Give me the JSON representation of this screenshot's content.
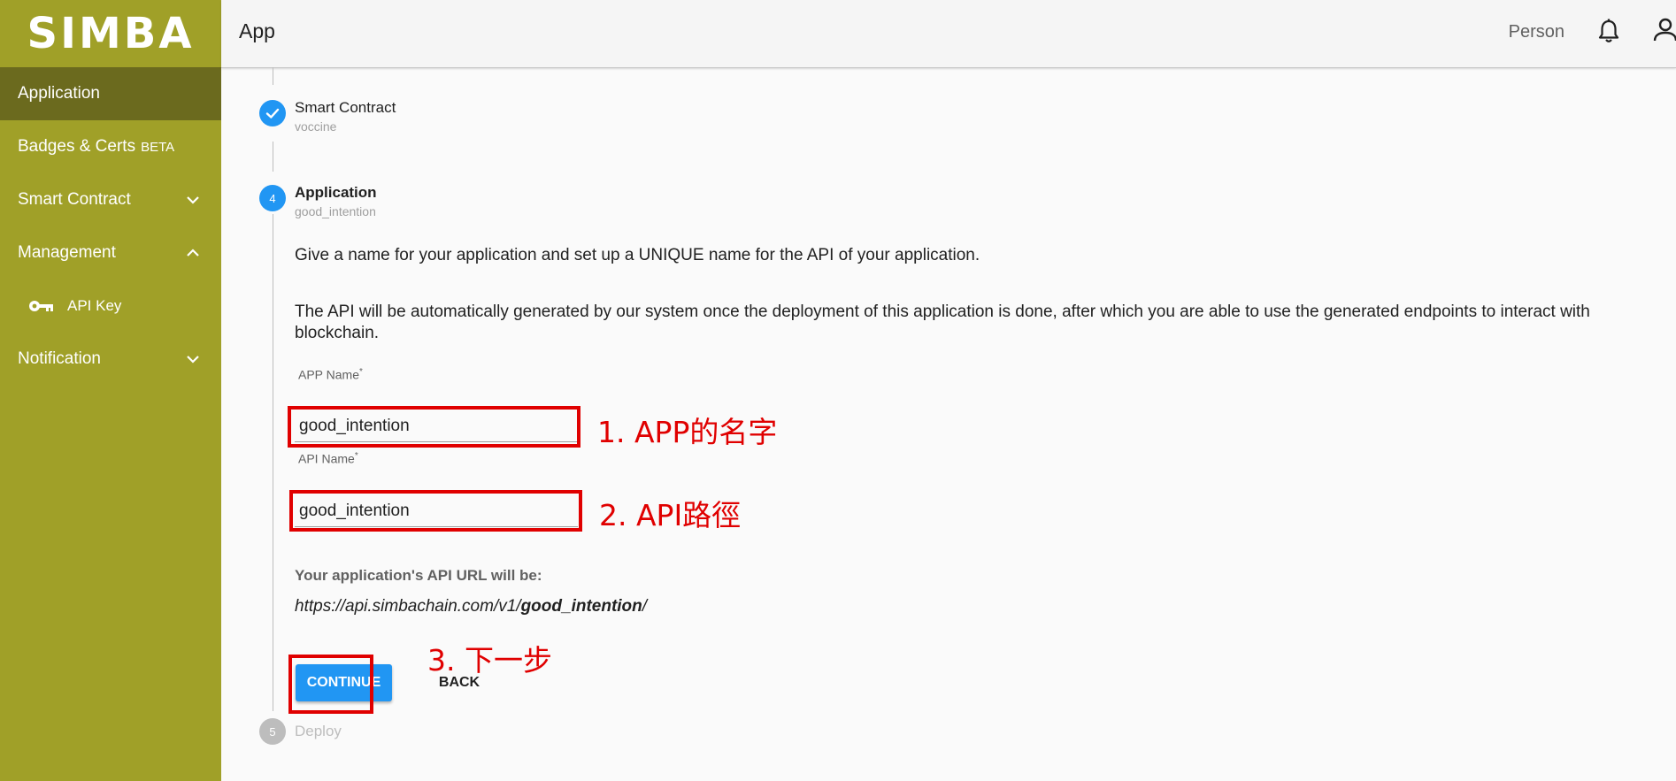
{
  "sidebar": {
    "brand": "SIMBA",
    "items": [
      {
        "label": "Application"
      },
      {
        "label": "Badges & Certs",
        "badge": "BETA"
      },
      {
        "label": "Smart Contract"
      },
      {
        "label": "Management"
      },
      {
        "label": "API Key"
      },
      {
        "label": "Notification"
      }
    ]
  },
  "header": {
    "title": "App",
    "person": "Person"
  },
  "stepper": {
    "step3": {
      "title": "Smart Contract",
      "subtitle": "voccine"
    },
    "step4": {
      "number": "4",
      "title": "Application",
      "subtitle": "good_intention"
    },
    "step5": {
      "number": "5",
      "title": "Deploy"
    }
  },
  "form": {
    "intro": "Give a name for your application and set up a UNIQUE name for the API of your application.",
    "description": "The API will be automatically generated by our system once the deployment of this application is done, after which you are able to use the generated endpoints to interact with blockchain.",
    "app_name_label": "APP Name",
    "app_name_value": "good_intention",
    "api_name_label": "API Name",
    "api_name_value": "good_intention",
    "required_mark": "*",
    "url_label": "Your application's API URL will be:",
    "url_prefix": "https://api.simbachain.com/v1/",
    "url_name": "good_intention",
    "url_suffix": "/",
    "continue": "CONTINUE",
    "back": "BACK"
  },
  "annotations": {
    "a1": "1. APP的名字",
    "a2": "2. API路徑",
    "a3": "3. 下一步"
  },
  "colors": {
    "sidebar": "#a0a028",
    "sidebar_active": "#6b6a1e",
    "step_active": "#2196f3",
    "annotation": "#e00000"
  }
}
